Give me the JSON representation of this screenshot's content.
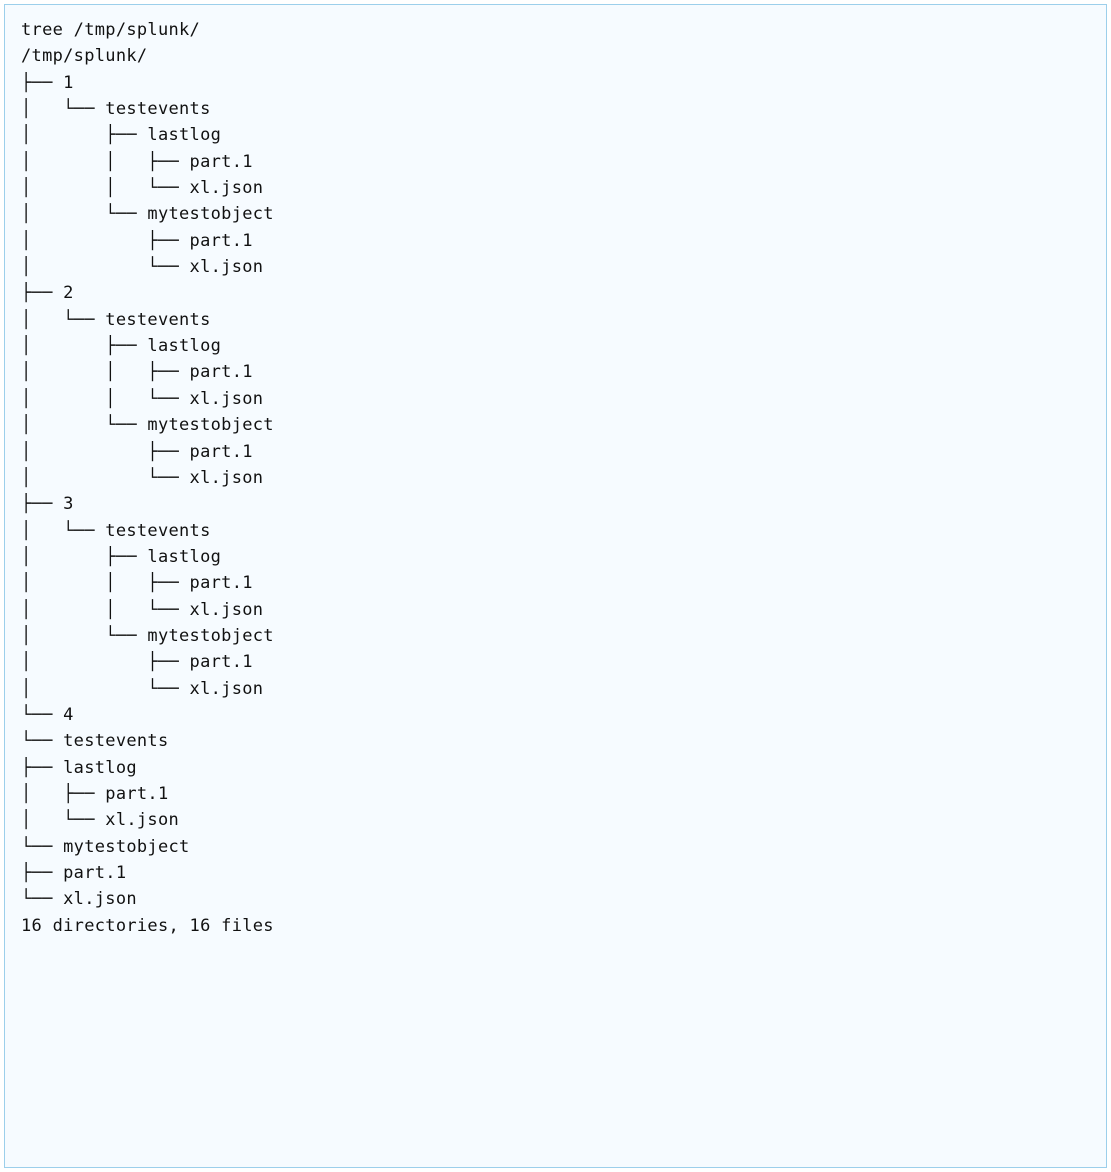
{
  "command": "tree /tmp/splunk/",
  "root": "/tmp/splunk/",
  "lines": [
    "├── 1",
    "│   └── testevents",
    "│       ├── lastlog",
    "│       │   ├── part.1",
    "│       │   └── xl.json",
    "│       └── mytestobject",
    "│           ├── part.1",
    "│           └── xl.json",
    "├── 2",
    "│   └── testevents",
    "│       ├── lastlog",
    "│       │   ├── part.1",
    "│       │   └── xl.json",
    "│       └── mytestobject",
    "│           ├── part.1",
    "│           └── xl.json",
    "├── 3",
    "│   └── testevents",
    "│       ├── lastlog",
    "│       │   ├── part.1",
    "│       │   └── xl.json",
    "│       └── mytestobject",
    "│           ├── part.1",
    "│           └── xl.json",
    "└── 4",
    "└── testevents",
    "├── lastlog",
    "│   ├── part.1",
    "│   └── xl.json",
    "└── mytestobject",
    "├── part.1",
    "└── xl.json"
  ],
  "summary": "16 directories, 16 files"
}
